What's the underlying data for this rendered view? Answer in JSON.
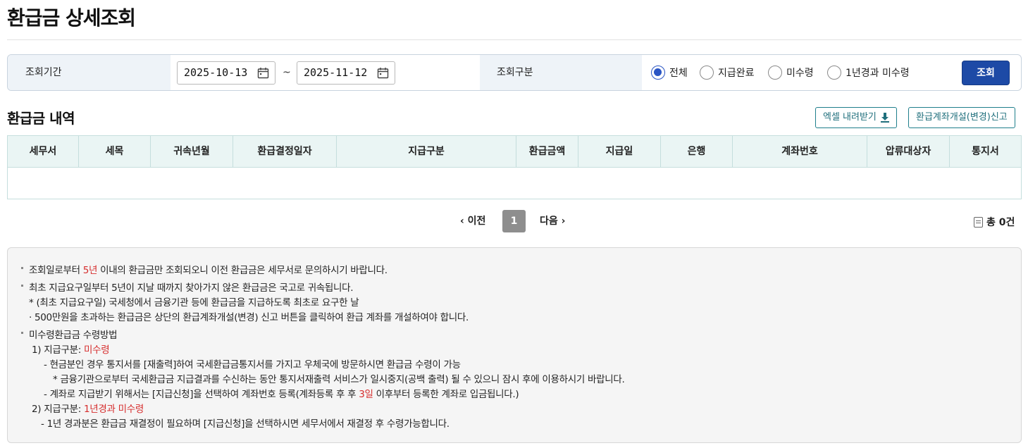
{
  "page": {
    "title": "환급금 상세조회"
  },
  "search": {
    "period_label": "조회기간",
    "date_from": "2025-10-13",
    "date_sep": "~",
    "date_to": "2025-11-12",
    "type_label": "조회구분",
    "options": [
      {
        "label": "전체",
        "selected": true
      },
      {
        "label": "지급완료",
        "selected": false
      },
      {
        "label": "미수령",
        "selected": false
      },
      {
        "label": "1년경과 미수령",
        "selected": false
      }
    ],
    "search_button": "조회"
  },
  "list": {
    "title": "환급금 내역",
    "excel_button": "엑셀 내려받기",
    "account_button": "환급계좌개설(변경)신고",
    "columns": [
      "세무서",
      "세목",
      "귀속년월",
      "환급결정일자",
      "지급구분",
      "환급금액",
      "지급일",
      "은행",
      "계좌번호",
      "압류대상자",
      "통지서"
    ],
    "rows": []
  },
  "pagination": {
    "prev": "이전",
    "current": "1",
    "next": "다음",
    "total": "총 0건"
  },
  "notice": {
    "l1a": "조회일로부터 ",
    "l1b": "5년",
    "l1c": " 이내의 환급금만 조회되오니 이전 환급금은 세무서로 문의하시기 바랍니다.",
    "l2": "최초 지급요구일부터 5년이 지날 때까지 찾아가지 않은 환급금은 국고로 귀속됩니다.",
    "l3": "* (최초 지급요구일) 국세청에서 금융기관 등에 환급금을 지급하도록 최초로 요구한 날",
    "l4": "· 500만원을 초과하는 환급금은 상단의 환급계좌개설(변경) 신고 버튼을 클릭하여 환급 계좌를 개설하여야 합니다.",
    "l5": "미수령환급금 수령방법",
    "l6a": "1) 지급구분: ",
    "l6b": "미수령",
    "l7": "- 현금분인 경우 통지서를 [재출력]하여 국세환급금통지서를 가지고 우체국에 방문하시면 환급금 수령이 가능",
    "l8": "* 금융기관으로부터 국세환급금 지급결과를 수신하는 동안 통지서재출력 서비스가 일시중지(공백 출력) 될 수 있으니 잠시 후에 이용하시기 바랍니다.",
    "l9a": "- 계좌로 지급받기 위해서는 [지급신청]을 선택하여 계좌번호 등록(계좌등록 후 후 ",
    "l9b": "3일",
    "l9c": " 이후부터 등록한 계좌로 입금됩니다.)",
    "l10a": "2) 지급구분: ",
    "l10b": "1년경과 미수령",
    "l11": "- 1년 경과분은 환급금 재결정이 필요하며 [지급신청]을 선택하시면 세무서에서 재결정 후 수령가능합니다."
  },
  "colors": {
    "primary": "#1d4aa6",
    "radio": "#2a55c4",
    "teal": "#1f6f7c",
    "highlight": "#d62d2d"
  }
}
